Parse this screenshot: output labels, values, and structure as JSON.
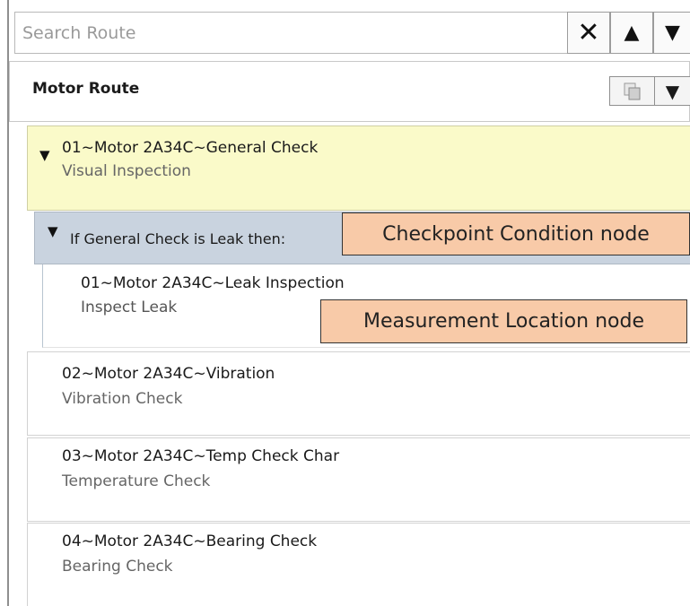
{
  "search": {
    "placeholder": "Search Route"
  },
  "search_buttons": {
    "clear": "✕",
    "up": "▲",
    "down": "▼"
  },
  "route": {
    "title": "Motor Route",
    "menu": "▼"
  },
  "nodes": [
    {
      "title": "01~Motor 2A34C~General Check",
      "subtitle": "Visual Inspection",
      "expanded": true,
      "highlighted": true
    },
    {
      "title": "02~Motor 2A34C~Vibration",
      "subtitle": "Vibration Check"
    },
    {
      "title": "03~Motor 2A34C~Temp Check Char",
      "subtitle": "Temperature Check"
    },
    {
      "title": "04~Motor 2A34C~Bearing Check",
      "subtitle": "Bearing Check"
    }
  ],
  "condition": {
    "label": "If General Check is Leak then:",
    "expanded": true
  },
  "child": {
    "title": "01~Motor 2A34C~Leak Inspection",
    "subtitle": "Inspect Leak"
  },
  "callouts": {
    "condition": "Checkpoint Condition node",
    "measurement": "Measurement Location node"
  },
  "colors": {
    "highlight": "#fafac9",
    "condition_bg": "#c9d3df",
    "callout_bg": "#f8caa8"
  },
  "icons": {
    "expand": "▼"
  }
}
